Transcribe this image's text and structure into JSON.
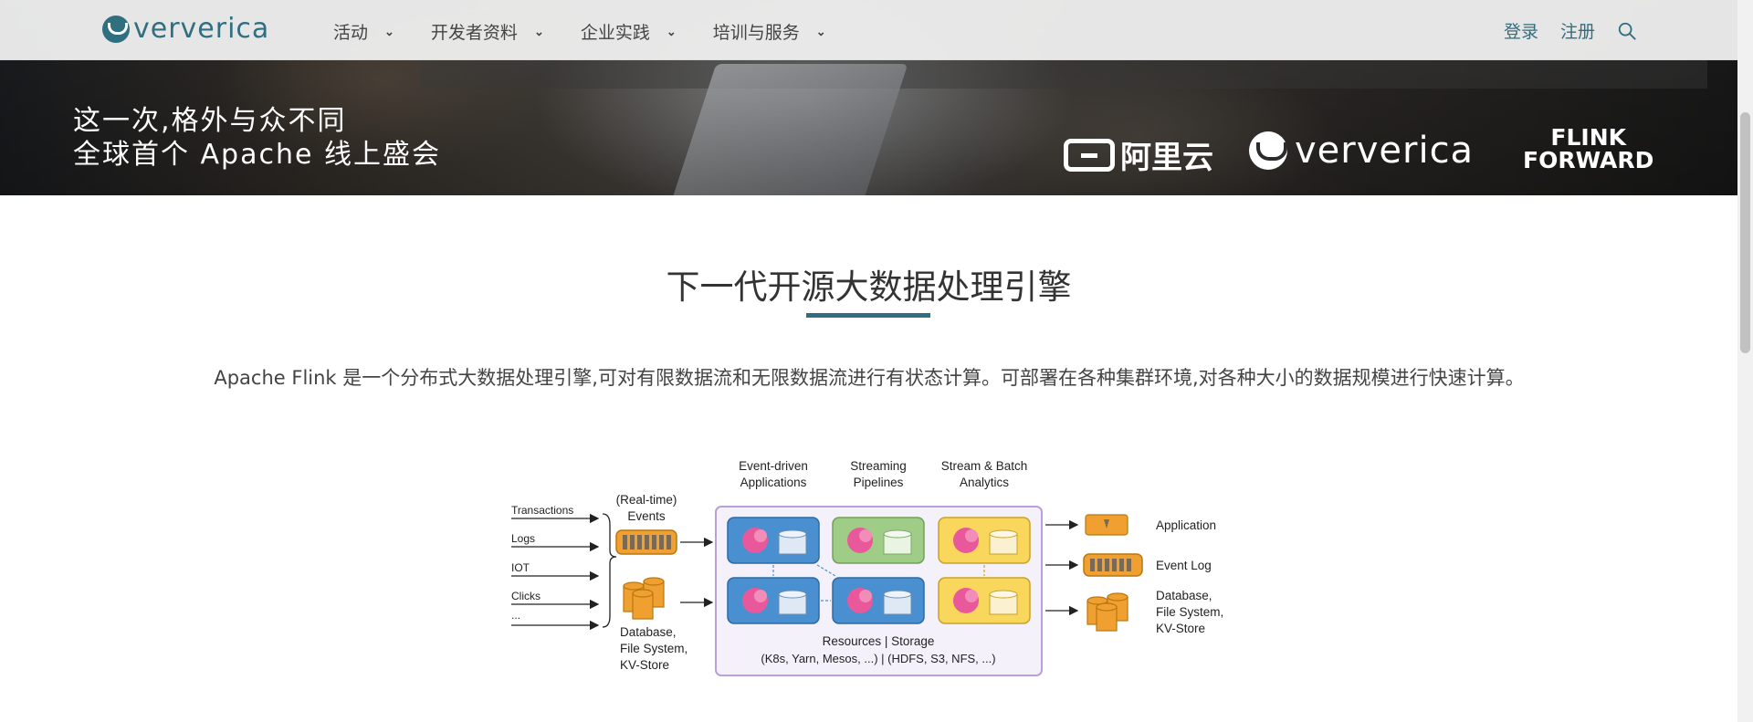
{
  "header": {
    "brand": "ververica",
    "nav": [
      {
        "label": "活动"
      },
      {
        "label": "开发者资料"
      },
      {
        "label": "企业实践"
      },
      {
        "label": "培训与服务"
      }
    ],
    "login": "登录",
    "register": "注册"
  },
  "banner": {
    "line1": "这一次,格外与众不同",
    "line2": "全球首个 Apache 线上盛会",
    "logo_aliyun": "阿里云",
    "logo_ververica": "ververica",
    "logo_ff_line1": "FLINK",
    "logo_ff_line2": "FORWARD"
  },
  "main": {
    "title": "下一代开源大数据处理引擎",
    "description": "Apache Flink 是一个分布式大数据处理引擎,可对有限数据流和无限数据流进行有状态计算。可部署在各种集群环境,对各种大小的数据规模进行快速计算。"
  },
  "diagram": {
    "inputs": [
      "Transactions",
      "Logs",
      "IOT",
      "Clicks",
      "..."
    ],
    "realtime_events": [
      "(Real-time)",
      "Events"
    ],
    "db_left": [
      "Database,",
      "File System,",
      "KV-Store"
    ],
    "col_headers": [
      [
        "Event-driven",
        "Applications"
      ],
      [
        "Streaming",
        "Pipelines"
      ],
      [
        "Stream & Batch",
        "Analytics"
      ]
    ],
    "resources": [
      "Resources | Storage",
      "(K8s, Yarn, Mesos, ...) | (HDFS, S3, NFS, ...)"
    ],
    "outputs": [
      "Application",
      "Event Log"
    ],
    "db_right": [
      "Database,",
      "File System,",
      "KV-Store"
    ],
    "colors": {
      "blue": "#4a90d0",
      "green": "#9fcc86",
      "yellow": "#f9d65c",
      "orange": "#f0a030",
      "purple": "#b9a0d8",
      "teal": "#2f6f80"
    }
  }
}
